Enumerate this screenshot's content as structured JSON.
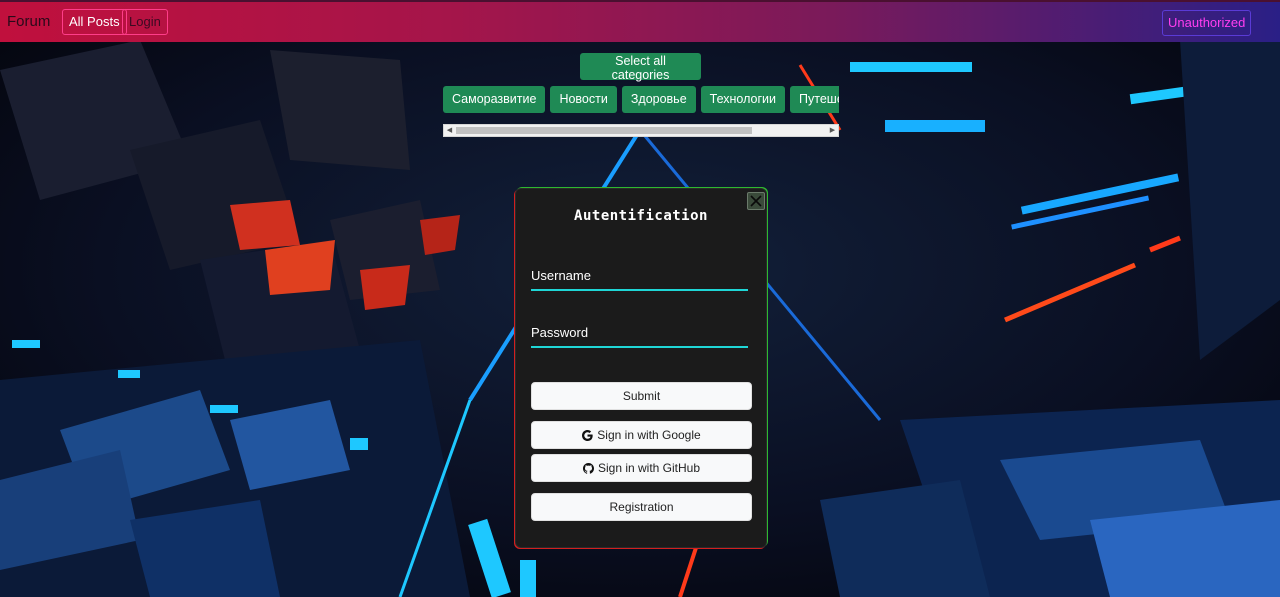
{
  "navbar": {
    "brand": "Forum",
    "all_posts_label": "All Posts",
    "login_label": "Login",
    "status_label": "Unauthorized"
  },
  "categories": {
    "select_all_label": "Select all categories",
    "items": [
      "Саморазвитие",
      "Новости",
      "Здоровье",
      "Технологии",
      "Путешествия"
    ]
  },
  "auth_modal": {
    "title": "Autentification",
    "username_label": "Username",
    "password_label": "Password",
    "submit_label": "Submit",
    "google_label": "Sign in with Google",
    "github_label": "Sign in with GitHub",
    "registration_label": "Registration"
  },
  "icons": {
    "close": "close-icon",
    "google": "google-icon",
    "github": "github-icon",
    "scroll_left": "chevron-left-icon",
    "scroll_right": "chevron-right-icon"
  },
  "colors": {
    "navbar_start": "#c0103d",
    "navbar_end": "#2a1f86",
    "category_green": "#1f8a55",
    "input_underline": "#1fd6d6",
    "modal_bg": "#1b1b1b",
    "status_text": "#ff3df0"
  }
}
